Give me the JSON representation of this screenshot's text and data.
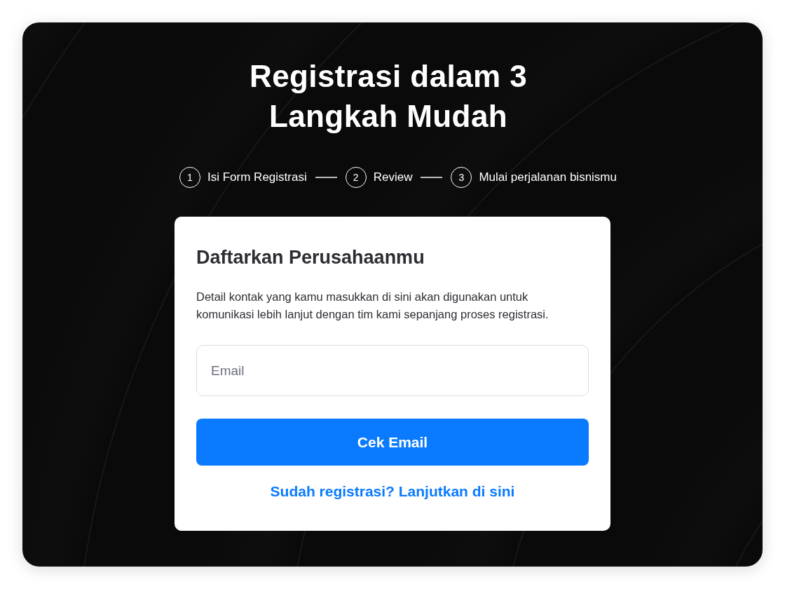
{
  "title": "Registrasi dalam 3 Langkah Mudah",
  "steps": [
    {
      "number": "1",
      "label": "Isi Form Registrasi"
    },
    {
      "number": "2",
      "label": "Review"
    },
    {
      "number": "3",
      "label": "Mulai perjalanan bisnismu"
    }
  ],
  "form": {
    "heading": "Daftarkan Perusahaanmu",
    "description": "Detail kontak yang kamu masukkan di sini akan digunakan untuk komunikasi lebih lanjut dengan tim kami sepanjang proses registrasi.",
    "email_field": {
      "placeholder": "Email"
    },
    "submit_button": "Cek Email",
    "login_link": "Sudah registrasi? Lanjutkan di sini"
  }
}
